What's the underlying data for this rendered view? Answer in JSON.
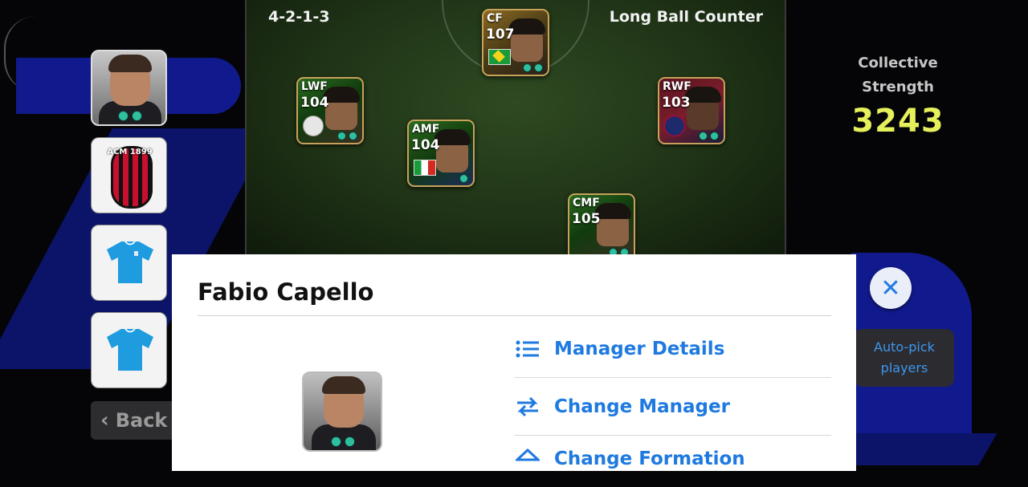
{
  "pitch": {
    "formation": "4-2-1-3",
    "tactic": "Long Ball Counter",
    "players": [
      {
        "pos": "CF",
        "ovr": "107",
        "badge": "Brazil"
      },
      {
        "pos": "LWF",
        "ovr": "104",
        "badge": "club crest"
      },
      {
        "pos": "RWF",
        "ovr": "103",
        "badge": "PSG"
      },
      {
        "pos": "AMF",
        "ovr": "104",
        "badge": "Italy"
      },
      {
        "pos": "CMF",
        "ovr": "105",
        "badge": "club crest"
      }
    ]
  },
  "sidebar": {
    "club_crest_year": "ACM 1899",
    "back_label": "Back"
  },
  "stats": {
    "strength_label_1": "Collective",
    "strength_label_2": "Strength",
    "strength_value": "3243"
  },
  "autopick": {
    "line1": "Auto-pick",
    "line2": "players"
  },
  "modal": {
    "title": "Fabio Capello",
    "menu": [
      {
        "label": "Manager Details",
        "icon": "list-icon"
      },
      {
        "label": "Change Manager",
        "icon": "swap-arrows-icon"
      },
      {
        "label": "Change Formation",
        "icon": "formation-icon"
      }
    ]
  },
  "colors": {
    "accent_blue": "#1f7ae0",
    "strength_yellow": "#e6f05a",
    "rating_dot": "#2fbf9f"
  }
}
